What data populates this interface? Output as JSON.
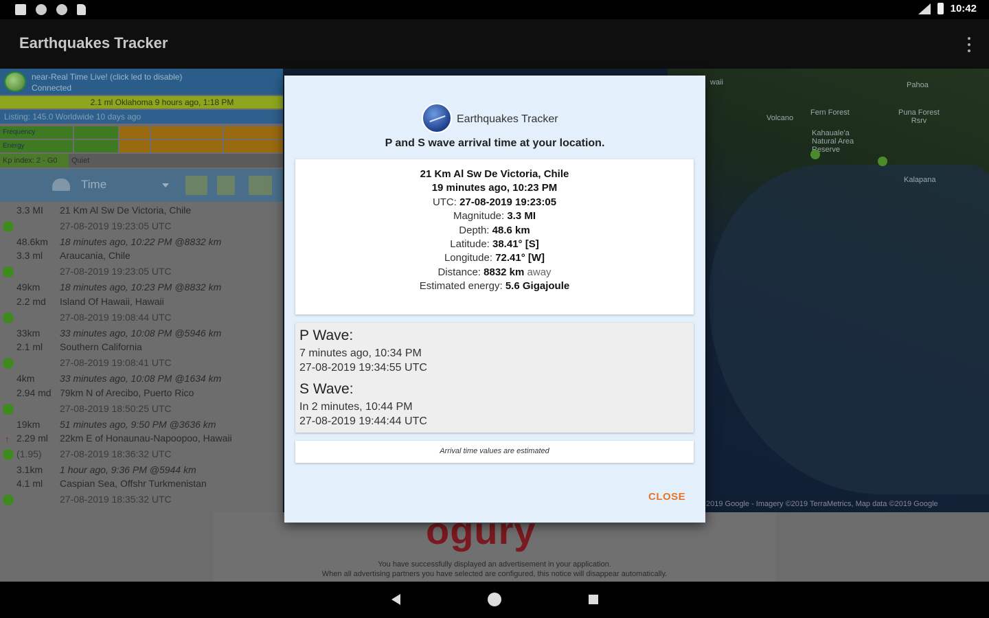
{
  "status_bar": {
    "time": "10:42"
  },
  "app": {
    "title": "Earthquakes Tracker"
  },
  "left_panel": {
    "live_text": "near-Real Time Live! (click led to disable)",
    "live_status": "Connected",
    "banner": "2.1 ml Oklahoma 9 hours ago, 1:18 PM",
    "listing": "Listing: 145.0 Worldwide 10 days ago",
    "frequency_label": "Frequency",
    "energy_label": "Energy",
    "kp_label": "Kp index: 2 - G0",
    "kp_status": "Quiet",
    "sort_label": "Time",
    "quakes": [
      {
        "mag": "3.3 MI",
        "place": "21 Km Al Sw De Victoria, Chile",
        "utc": "27-08-2019 19:23:05 UTC",
        "dist": "48.6km",
        "ago": "18 minutes ago, 10:22 PM @8832 km",
        "extra": ""
      },
      {
        "mag": "3.3 ml",
        "place": "Araucania, Chile",
        "utc": "27-08-2019 19:23:05 UTC",
        "dist": "49km",
        "ago": "18 minutes ago, 10:23 PM @8832 km",
        "extra": ""
      },
      {
        "mag": "2.2 md",
        "place": "Island Of Hawaii, Hawaii",
        "utc": "27-08-2019 19:08:44 UTC",
        "dist": "33km",
        "ago": "33 minutes ago, 10:08 PM @5946 km",
        "extra": ""
      },
      {
        "mag": "2.1 ml",
        "place": "Southern California",
        "utc": "27-08-2019 19:08:41 UTC",
        "dist": "4km",
        "ago": "33 minutes ago, 10:08 PM @1634 km",
        "extra": ""
      },
      {
        "mag": "2.94 md",
        "place": "79km N of Arecibo, Puerto Rico",
        "utc": "27-08-2019 18:50:25 UTC",
        "dist": "19km",
        "ago": "51 minutes ago, 9:50 PM @3636 km",
        "extra": ""
      },
      {
        "mag": "2.29 ml",
        "place": "22km E of Honaunau-Napoopoo, Hawaii",
        "utc": "27-08-2019 18:36:32 UTC",
        "dist": "3.1km",
        "ago": "1 hour ago, 9:36 PM @5944 km",
        "extra": "(1.95)"
      },
      {
        "mag": "4.1 ml",
        "place": "Caspian Sea, Offshr Turkmenistan",
        "utc": "27-08-2019 18:35:32 UTC",
        "dist": "",
        "ago": "",
        "extra": ""
      }
    ]
  },
  "map": {
    "labels": [
      "Pahoa",
      "Fern Forest",
      "Puna Forest Rsrv",
      "Volcano",
      "Kahauale'a Natural Area Reserve",
      "Kalapana",
      "waii"
    ],
    "credit": "2019 Google - Imagery ©2019 TerraMetrics, Map data ©2019 Google"
  },
  "ad": {
    "logo": "ogury",
    "line1": "You have successfully displayed an advertisement in your application.",
    "line2": "When all advertising partners you have selected are configured, this notice will disappear automatically."
  },
  "dialog": {
    "app_name": "Earthquakes Tracker",
    "subtitle": "P and S wave arrival time at your location.",
    "info": {
      "place": "21 Km Al Sw De Victoria, Chile",
      "time": "19 minutes ago, 10:23 PM",
      "utc_label": "UTC:",
      "utc_value": "27-08-2019 19:23:05",
      "magnitude_label": "Magnitude:",
      "magnitude_value": "3.3 MI",
      "depth_label": "Depth:",
      "depth_value": "48.6 km",
      "latitude_label": "Latitude:",
      "latitude_value": "38.41° [S]",
      "longitude_label": "Longitude:",
      "longitude_value": "72.41° [W]",
      "distance_label": "Distance:",
      "distance_value": "8832 km",
      "distance_suffix": "away",
      "energy_label": "Estimated energy:",
      "energy_value": "5.6 Gigajoule"
    },
    "p_wave": {
      "title": "P Wave:",
      "relative": "7 minutes ago, 10:34 PM",
      "utc": "27-08-2019 19:34:55 UTC"
    },
    "s_wave": {
      "title": "S Wave:",
      "relative": "In 2 minutes, 10:44 PM",
      "utc": "27-08-2019 19:44:44 UTC"
    },
    "note": "Arrival time values are estimated",
    "close_label": "CLOSE"
  },
  "colors": {
    "accent": "#e5752a",
    "dialog_bg": "#e3f0fb",
    "led_green": "#3f8a1f"
  }
}
